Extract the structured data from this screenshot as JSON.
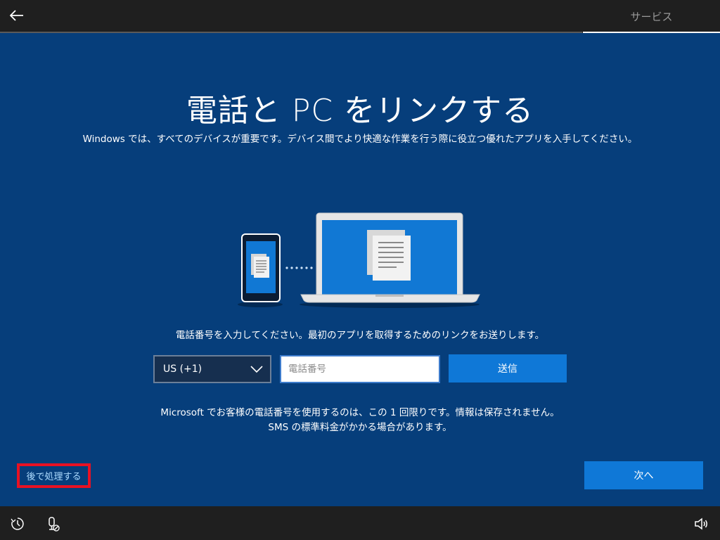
{
  "header": {
    "back_icon": "arrow-left-icon",
    "service_tab": "サービス"
  },
  "main": {
    "title": "電話と PC をリンクする",
    "subtitle": "Windows では、すべてのデバイスが重要です。デバイス間でより快適な作業を行う際に役立つ優れたアプリを入手してください。",
    "prompt": "電話番号を入力してください。最初のアプリを取得するためのリンクをお送りします。",
    "country_select": {
      "value": "US (+1)"
    },
    "phone_input": {
      "placeholder": "電話番号",
      "value": ""
    },
    "send_label": "送信",
    "notice": "Microsoft でお客様の電話番号を使用するのは、この 1 回限りです。情報は保存されません。SMS の標準料金がかかる場合があります。"
  },
  "footer": {
    "later_label": "後で処理する",
    "next_label": "次へ"
  },
  "bottombar": {
    "icons": [
      "ease-of-access-icon",
      "narrator-microphone-icon",
      "volume-icon"
    ]
  },
  "colors": {
    "background": "#063e7b",
    "accent": "#0f78d7",
    "highlight_border": "#e81123"
  }
}
